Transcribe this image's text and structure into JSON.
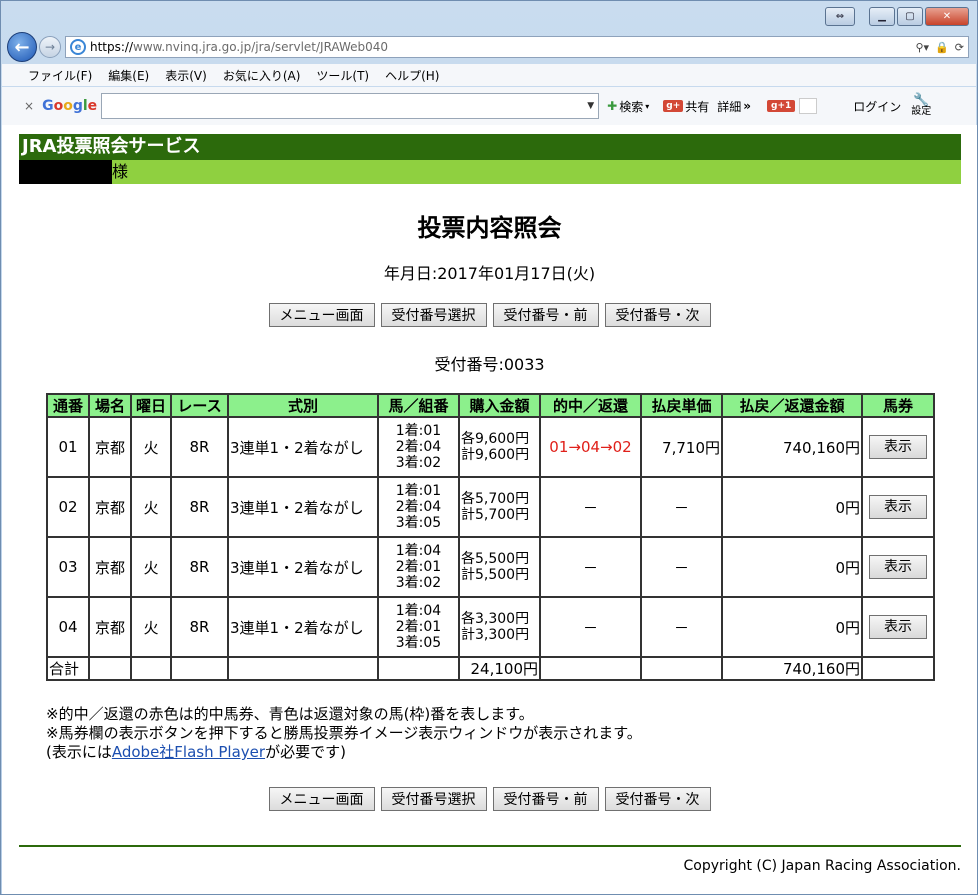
{
  "browser": {
    "url_scheme": "https://",
    "url_rest": "www.nvinq.jra.go.jp/jra/servlet/JRAWeb040",
    "menu": [
      "ファイル(F)",
      "編集(E)",
      "表示(V)",
      "お気に入り(A)",
      "ツール(T)",
      "ヘルプ(H)"
    ],
    "google": {
      "search_label": "検索",
      "share_label": "共有",
      "more_label": "詳細",
      "more_arrows": "»",
      "login_label": "ログイン",
      "settings_label": "設定"
    }
  },
  "page": {
    "service_title": "JRA投票照会サービス",
    "sama": "様",
    "heading": "投票内容照会",
    "date_line": "年月日:2017年01月17日(火)",
    "buttons": [
      "メニュー画面",
      "受付番号選択",
      "受付番号・前",
      "受付番号・次"
    ],
    "receipt": "受付番号:0033",
    "table": {
      "headers": [
        "通番",
        "場名",
        "曜日",
        "レース",
        "式別",
        "馬／組番",
        "購入金額",
        "的中／返還",
        "払戻単価",
        "払戻／返還金額",
        "馬券"
      ],
      "rows": [
        {
          "no": "01",
          "place": "京都",
          "day": "火",
          "race": "8R",
          "type": "3連単1・2着ながし",
          "kumi1": "1着:01",
          "kumi2": "2着:04",
          "kumi3": "3着:02",
          "kin1": "各9,600円",
          "kin2": "計9,600円",
          "hit": "01→04→02",
          "unit": "7,710円",
          "payout": "740,160円",
          "btn": "表示"
        },
        {
          "no": "02",
          "place": "京都",
          "day": "火",
          "race": "8R",
          "type": "3連単1・2着ながし",
          "kumi1": "1着:01",
          "kumi2": "2着:04",
          "kumi3": "3着:05",
          "kin1": "各5,700円",
          "kin2": "計5,700円",
          "hit": "－",
          "unit": "－",
          "payout": "0円",
          "btn": "表示"
        },
        {
          "no": "03",
          "place": "京都",
          "day": "火",
          "race": "8R",
          "type": "3連単1・2着ながし",
          "kumi1": "1着:04",
          "kumi2": "2着:01",
          "kumi3": "3着:02",
          "kin1": "各5,500円",
          "kin2": "計5,500円",
          "hit": "－",
          "unit": "－",
          "payout": "0円",
          "btn": "表示"
        },
        {
          "no": "04",
          "place": "京都",
          "day": "火",
          "race": "8R",
          "type": "3連単1・2着ながし",
          "kumi1": "1着:04",
          "kumi2": "2着:01",
          "kumi3": "3着:05",
          "kin1": "各3,300円",
          "kin2": "計3,300円",
          "hit": "－",
          "unit": "－",
          "payout": "0円",
          "btn": "表示"
        }
      ],
      "total_label": "合計",
      "total_amount": "24,100円",
      "total_payout": "740,160円"
    },
    "notes": {
      "line1": "※的中／返還の赤色は的中馬券、青色は返還対象の馬(枠)番を表します。",
      "line2": "※馬券欄の表示ボタンを押下すると勝馬投票券イメージ表示ウィンドウが表示されます。",
      "line3_pre": "(表示には",
      "line3_link": "Adobe社Flash Player",
      "line3_post": "が必要です)"
    },
    "copyright": "Copyright (C) Japan Racing Association."
  }
}
